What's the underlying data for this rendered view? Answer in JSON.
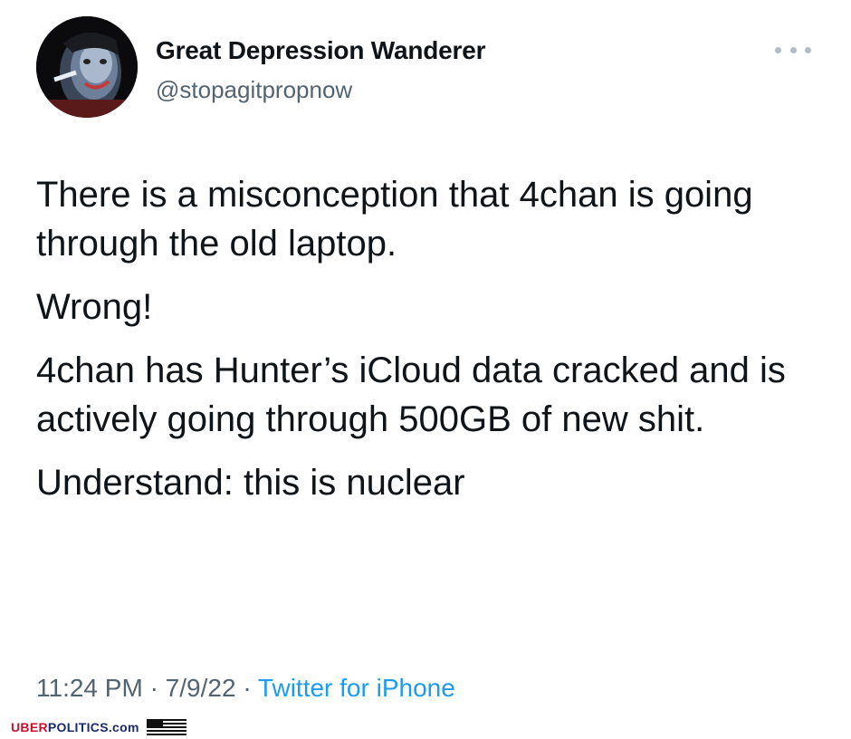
{
  "author": {
    "display_name": "Great Depression Wanderer",
    "handle": "@stopagitpropnow"
  },
  "tweet": {
    "paragraphs": [
      "There is a misconception that 4chan is going through the old laptop.",
      "Wrong!",
      "4chan has Hunter’s iCloud data cracked and is actively going through 500GB of new shit.",
      "Understand: this is nuclear"
    ],
    "time": "11:24 PM",
    "date": "7/9/22",
    "separator": "·",
    "source": "Twitter for iPhone"
  },
  "watermark": {
    "uber": "UBER",
    "rest": "POLITICS.com"
  },
  "colors": {
    "text": "#0f1419",
    "secondary": "#536471",
    "link": "#1d9bf0",
    "watermark_red": "#c8102e",
    "watermark_blue": "#1a2a6c"
  },
  "icons": {
    "more": "more-horizontal-icon",
    "flag": "us-flag-icon"
  }
}
